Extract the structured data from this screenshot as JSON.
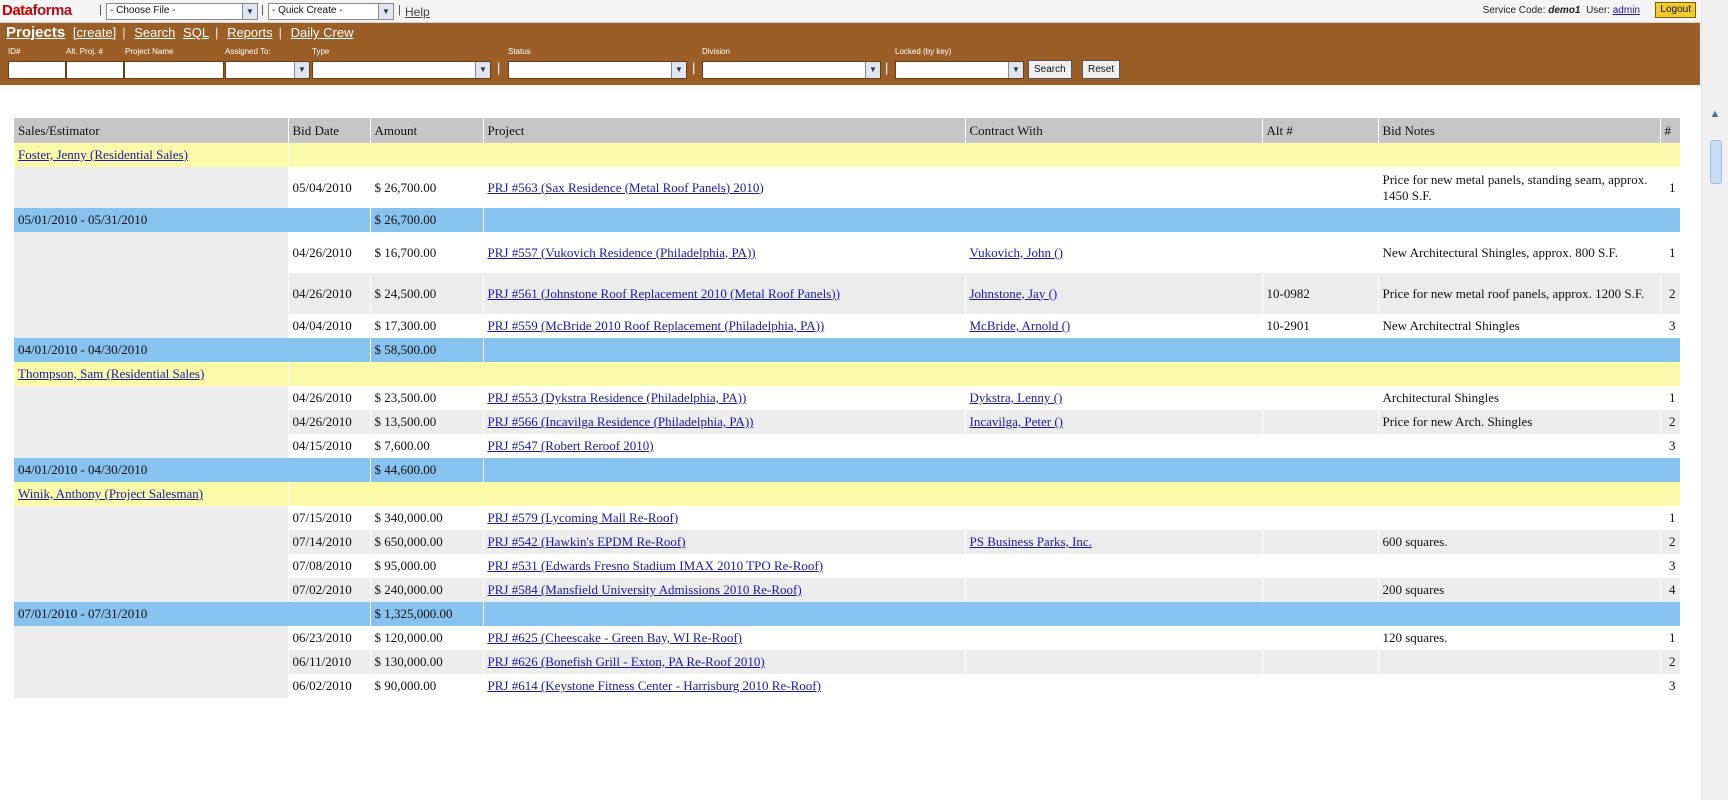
{
  "topbar": {
    "logo": "Dataforma",
    "choose_file": "- Choose File -",
    "quick_create": "- Quick Create -",
    "help": "Help",
    "service_code_label": "Service Code:",
    "service_code": "demo1",
    "user_label": "User:",
    "user": "admin",
    "logout": "Logout"
  },
  "nav": {
    "projects": "Projects",
    "create": "[create]",
    "search": "Search",
    "sql": "SQL",
    "reports": "Reports",
    "daily_crew": "Daily Crew",
    "filters": {
      "id": "ID#",
      "alt_proj": "Alt. Proj. #",
      "project_name": "Project Name",
      "assigned_to": "Assigned To:",
      "type": "Type",
      "status": "Status",
      "division": "Division",
      "locked": "Locked (by key)"
    },
    "search_button": "Search",
    "reset_button": "Reset"
  },
  "table": {
    "headers": [
      "Sales/Estimator",
      "Bid Date",
      "Amount",
      "Project",
      "Contract With",
      "Alt #",
      "Bid Notes",
      "#"
    ],
    "groups": [
      {
        "estimator": "Foster, Jenny  (Residential Sales)",
        "periods": [
          {
            "rows": [
              {
                "date": "05/04/2010",
                "amount": "$ 26,700.00",
                "project": "PRJ #563 (Sax Residence (Metal Roof Panels) 2010)",
                "contract": "",
                "alt": "",
                "notes": "Price for new metal panels, standing seam, approx. 1450 S.F.",
                "n": "1"
              }
            ],
            "range": "05/01/2010 - 05/31/2010",
            "total": "$ 26,700.00"
          },
          {
            "rows": [
              {
                "date": "04/26/2010",
                "amount": "$ 16,700.00",
                "project": "PRJ #557 (Vukovich Residence (Philadelphia, PA))",
                "contract": "Vukovich, John  ()",
                "alt": "",
                "notes": "New Architectural Shingles, approx. 800 S.F.",
                "n": "1"
              },
              {
                "date": "04/26/2010",
                "amount": "$ 24,500.00",
                "project": "PRJ #561 (Johnstone Roof Replacement 2010 (Metal Roof Panels))",
                "contract": "Johnstone, Jay  ()",
                "alt": "10-0982",
                "notes": "Price for new metal roof panels, approx. 1200 S.F.",
                "n": "2"
              },
              {
                "date": "04/04/2010",
                "amount": "$ 17,300.00",
                "project": "PRJ #559 (McBride 2010 Roof Replacement (Philadelphia, PA))",
                "contract": "McBride, Arnold  ()",
                "alt": "10-2901",
                "notes": "New Architectral Shingles",
                "n": "3"
              }
            ],
            "range": "04/01/2010 - 04/30/2010",
            "total": "$ 58,500.00"
          }
        ]
      },
      {
        "estimator": "Thompson, Sam  (Residential Sales)",
        "periods": [
          {
            "rows": [
              {
                "date": "04/26/2010",
                "amount": "$ 23,500.00",
                "project": "PRJ #553 (Dykstra Residence (Philadelphia, PA))",
                "contract": "Dykstra, Lenny  ()",
                "alt": "",
                "notes": "Architectural Shingles",
                "n": "1"
              },
              {
                "date": "04/26/2010",
                "amount": "$ 13,500.00",
                "project": "PRJ #566 (Incavilga Residence (Philadelphia, PA))",
                "contract": "Incavilga, Peter  ()",
                "alt": "",
                "notes": "Price for new Arch. Shingles",
                "n": "2"
              },
              {
                "date": "04/15/2010",
                "amount": "$ 7,600.00",
                "project": "PRJ #547 (Robert Reroof 2010)",
                "contract": "",
                "alt": "",
                "notes": "",
                "n": "3"
              }
            ],
            "range": "04/01/2010 - 04/30/2010",
            "total": "$ 44,600.00"
          }
        ]
      },
      {
        "estimator": "Winik, Anthony  (Project Salesman)",
        "periods": [
          {
            "rows": [
              {
                "date": "07/15/2010",
                "amount": "$ 340,000.00",
                "project": "PRJ #579 (Lycoming Mall Re-Roof)",
                "contract": "",
                "alt": "",
                "notes": "",
                "n": "1"
              },
              {
                "date": "07/14/2010",
                "amount": "$ 650,000.00",
                "project": "PRJ #542 (Hawkin's EPDM Re-Roof)",
                "contract": "PS Business Parks, Inc.",
                "alt": "",
                "notes": "600 squares.",
                "n": "2"
              },
              {
                "date": "07/08/2010",
                "amount": "$ 95,000.00",
                "project": "PRJ #531 (Edwards Fresno Stadium IMAX 2010 TPO Re-Roof)",
                "contract": "",
                "alt": "",
                "notes": "",
                "n": "3"
              },
              {
                "date": "07/02/2010",
                "amount": "$ 240,000.00",
                "project": "PRJ #584 (Mansfield University Admissions 2010 Re-Roof)",
                "contract": "",
                "alt": "",
                "notes": "200 squares",
                "n": "4"
              }
            ],
            "range": "07/01/2010 - 07/31/2010",
            "total": "$ 1,325,000.00"
          },
          {
            "rows": [
              {
                "date": "06/23/2010",
                "amount": "$ 120,000.00",
                "project": "PRJ #625 (Cheescake - Green Bay, WI Re-Roof)",
                "contract": "",
                "alt": "",
                "notes": "120 squares.",
                "n": "1"
              },
              {
                "date": "06/11/2010",
                "amount": "$ 130,000.00",
                "project": "PRJ #626 (Bonefish Grill - Exton, PA Re-Roof 2010)",
                "contract": "",
                "alt": "",
                "notes": "",
                "n": "2"
              },
              {
                "date": "06/02/2010",
                "amount": "$ 90,000.00",
                "project": "PRJ #614 (Keystone Fitness Center - Harrisburg 2010 Re-Roof)",
                "contract": "",
                "alt": "",
                "notes": "",
                "n": "3"
              }
            ]
          }
        ]
      }
    ]
  }
}
